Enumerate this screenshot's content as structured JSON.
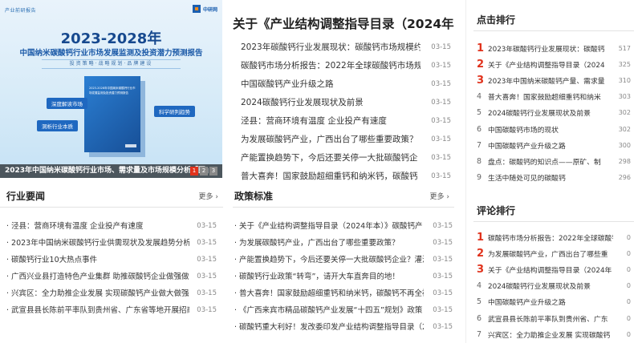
{
  "banner": {
    "brand": "产业前研报告",
    "logo": "中研网",
    "title": "2023-2028年",
    "subtitle": "中国纳米碳酸钙行业市场发展监测及投资潜力预测报告",
    "ribbon": "投资策略·战略规划·品牌建设",
    "book_title": "2023-2028年中国纳米碳酸钙行业市场发展监测及投资潜力预测报告",
    "tags": [
      "深度解读市场",
      "洞析行业本质",
      "科学研判趋势"
    ],
    "caption": "2023年中国纳米碳酸钙行业市场、需求量及市场规模分析「图」",
    "pages": [
      "1",
      "2",
      "3"
    ]
  },
  "headline": "关于《产业结构调整指导目录（2024年",
  "top_list": [
    {
      "title": "2023年碳酸钙行业发展现状：碳酸钙市场规模约",
      "date": "03-15"
    },
    {
      "title": "碳酸钙市场分析报告：2022年全球碳酸钙市场规",
      "date": "03-15"
    },
    {
      "title": "中国碳酸钙产业升级之路",
      "date": "03-15"
    },
    {
      "title": "2024碳酸钙行业发展现状及前景",
      "date": "03-15"
    },
    {
      "title": "泾县：营商环境有温度 企业投产有速度",
      "date": "03-15"
    },
    {
      "title": "为发展碳酸钙产业，广西出台了哪些重要政策？",
      "date": "03-15"
    },
    {
      "title": "产能置换趋势下，今后还要关停一大批碳酸钙企",
      "date": "03-15"
    },
    {
      "title": "普大喜奔！国家鼓励超细重钙和纳米钙，碳酸钙",
      "date": "03-15"
    }
  ],
  "industry": {
    "heading": "行业要闻",
    "more": "更多 ›",
    "items": [
      {
        "title": "· 泾县：营商环境有温度 企业投产有速度",
        "date": "03-15"
      },
      {
        "title": "· 2023年中国纳米碳酸钙行业供需现状及发展趋势分析,",
        "date": "03-15"
      },
      {
        "title": "· 碳酸钙行业10大热点事件",
        "date": "03-15"
      },
      {
        "title": "· 广西兴业县打造特色产业集群 助推碳酸钙企业做强做大",
        "date": "03-15"
      },
      {
        "title": "· 兴宾区：全力助推企业发展 实现碳酸钙产业做大做强",
        "date": "03-15"
      },
      {
        "title": "· 武宣县县长陈前平率队到贵州省、广东省等地开展招商引",
        "date": "03-15"
      }
    ]
  },
  "policy": {
    "heading": "政策标准",
    "more": "更多 ›",
    "items": [
      {
        "title": "· 关于《产业结构调整指导目录（2024年本）》碳酸钙产",
        "date": "03-15"
      },
      {
        "title": "· 为发展碳酸钙产业，广西出台了哪些重要政策？",
        "date": "03-15"
      },
      {
        "title": "· 产能置换趋势下，今后还要关停一大批碳酸钙企业？灌沮",
        "date": "03-15"
      },
      {
        "title": "· 碳酸钙行业政策“转弯”，请开大车直奔目的地！",
        "date": "03-15"
      },
      {
        "title": "· 普大喜奔！国家鼓励超细重钙和纳米钙，碳酸钙不再全被",
        "date": "03-15"
      },
      {
        "title": "· 《广西来宾市精品碳酸钙产业发展“十四五”规划》政策",
        "date": "03-15"
      },
      {
        "title": "· 碳酸钙重大利好！发改委印发产业结构调整指导目录（2",
        "date": "03-15"
      }
    ]
  },
  "hot_rank": {
    "heading": "点击排行",
    "items": [
      {
        "n": "1",
        "title": "2023年碳酸钙行业发展现状：碳酸钙",
        "count": "517"
      },
      {
        "n": "2",
        "title": "关于《产业结构调整指导目录（2024",
        "count": "325"
      },
      {
        "n": "3",
        "title": "2023年中国纳米碳酸钙产量、需求量",
        "count": "310"
      },
      {
        "n": "4",
        "title": "普大喜奔！国家鼓励超细重钙和纳米",
        "count": "303"
      },
      {
        "n": "5",
        "title": "2024碳酸钙行业发展现状及前景",
        "count": "302"
      },
      {
        "n": "6",
        "title": "中国碳酸钙市场的现状",
        "count": "302"
      },
      {
        "n": "7",
        "title": "中国碳酸钙产业升级之路",
        "count": "300"
      },
      {
        "n": "8",
        "title": "盘点：碳酸钙的知识点——原矿、制",
        "count": "298"
      },
      {
        "n": "9",
        "title": "生活中随处可见的碳酸钙",
        "count": "296"
      }
    ]
  },
  "comment_rank": {
    "heading": "评论排行",
    "items": [
      {
        "n": "1",
        "title": "碳酸钙市场分析报告：2022年全球碳酸钙",
        "count": "0"
      },
      {
        "n": "2",
        "title": "为发展碳酸钙产业，广西出台了哪些重",
        "count": "0"
      },
      {
        "n": "3",
        "title": "关于《产业结构调整指导目录（2024年",
        "count": "0"
      },
      {
        "n": "4",
        "title": "2024碳酸钙行业发展现状及前景",
        "count": "0"
      },
      {
        "n": "5",
        "title": "中国碳酸钙产业升级之路",
        "count": "0"
      },
      {
        "n": "6",
        "title": "武宣县县长陈前平率队到贵州省、广东",
        "count": "0"
      },
      {
        "n": "7",
        "title": "兴宾区：全力助推企业发展 实现碳酸钙",
        "count": "0"
      }
    ]
  },
  "colors": {
    "accent": "#e0321c",
    "link": "#333333",
    "muted": "#888888"
  }
}
